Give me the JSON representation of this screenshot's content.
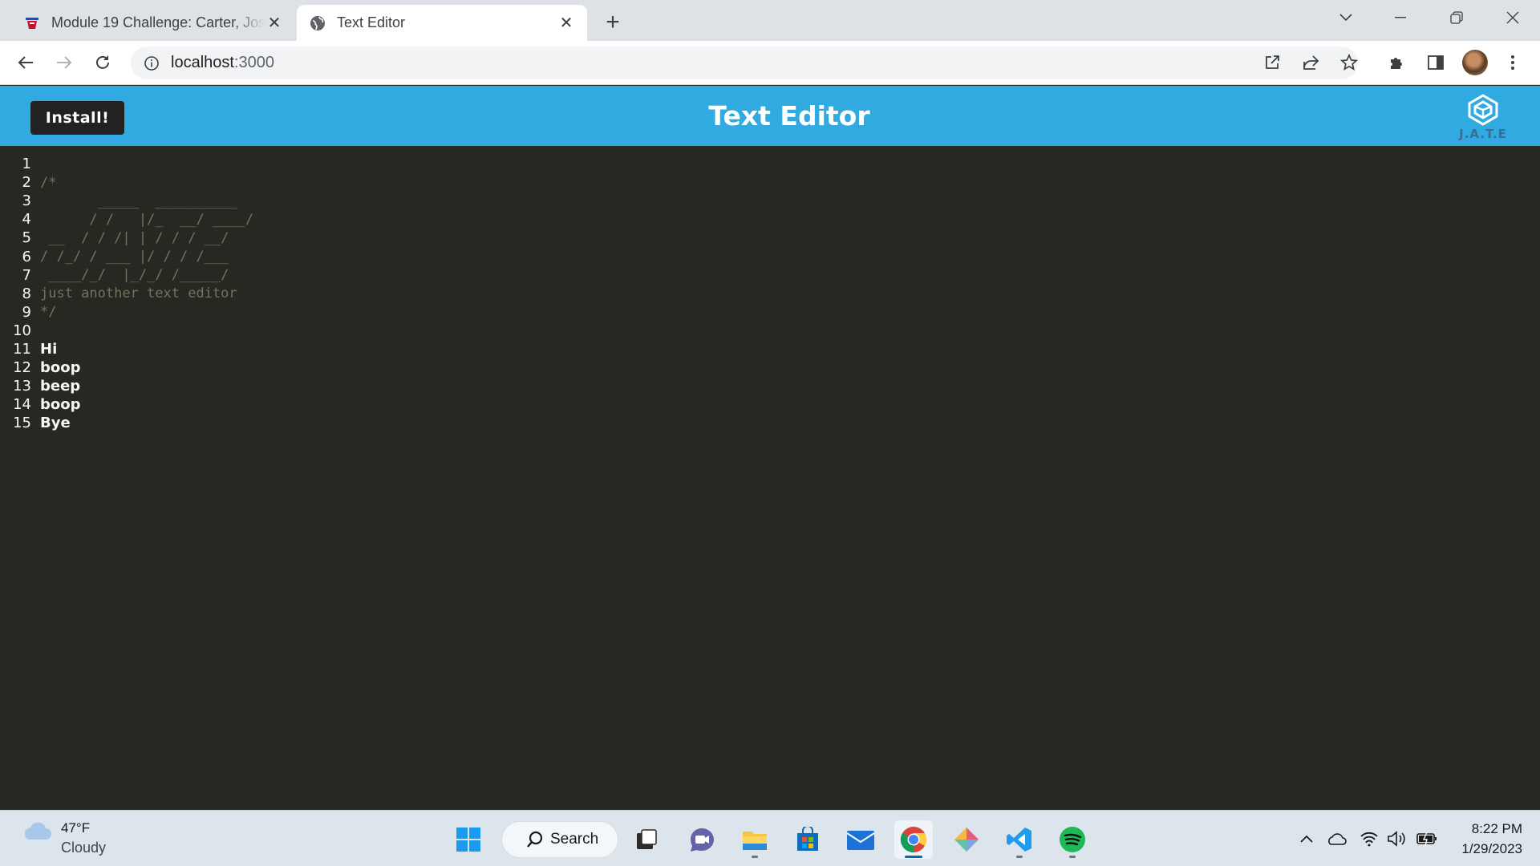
{
  "browser": {
    "tabs": [
      {
        "title": "Module 19 Challenge: Carter, Jos",
        "active": false
      },
      {
        "title": "Text Editor",
        "active": true
      }
    ],
    "url_host": "localhost",
    "url_port": ":3000"
  },
  "app": {
    "install_label": "Install!",
    "title": "Text Editor",
    "logo_text": "J.A.T.E"
  },
  "editor": {
    "lines": [
      {
        "n": "1",
        "text": "",
        "kind": "plain"
      },
      {
        "n": "2",
        "text": "/*",
        "kind": "comment"
      },
      {
        "n": "3",
        "text": "       _____  __________",
        "kind": "comment"
      },
      {
        "n": "4",
        "text": "      / /   |/_  __/ ____/",
        "kind": "comment"
      },
      {
        "n": "5",
        "text": " __  / / /| | / / / __/",
        "kind": "comment"
      },
      {
        "n": "6",
        "text": "/ /_/ / ___ |/ / / /___",
        "kind": "comment"
      },
      {
        "n": "7",
        "text": " ____/_/  |_/_/ /_____/",
        "kind": "comment"
      },
      {
        "n": "8",
        "text": "just another text editor",
        "kind": "comment"
      },
      {
        "n": "9",
        "text": "*/",
        "kind": "comment"
      },
      {
        "n": "10",
        "text": "",
        "kind": "plain"
      },
      {
        "n": "11",
        "text": "Hi",
        "kind": "plain"
      },
      {
        "n": "12",
        "text": "boop",
        "kind": "plain"
      },
      {
        "n": "13",
        "text": "beep",
        "kind": "plain"
      },
      {
        "n": "14",
        "text": "boop",
        "kind": "plain"
      },
      {
        "n": "15",
        "text": "Bye",
        "kind": "plain"
      }
    ]
  },
  "taskbar": {
    "weather_temp": "47°F",
    "weather_cond": "Cloudy",
    "search_label": "Search",
    "time": "8:22 PM",
    "date": "1/29/2023",
    "apps": [
      "windows-start-icon",
      "task-view-icon",
      "teams-chat-icon",
      "file-explorer-icon",
      "microsoft-store-icon",
      "mail-icon",
      "chrome-icon",
      "git-kraken-icon",
      "vscode-icon",
      "spotify-icon"
    ]
  },
  "colors": {
    "header_blue": "#31a9e1",
    "editor_bg": "#272822",
    "comment": "#75715e"
  }
}
